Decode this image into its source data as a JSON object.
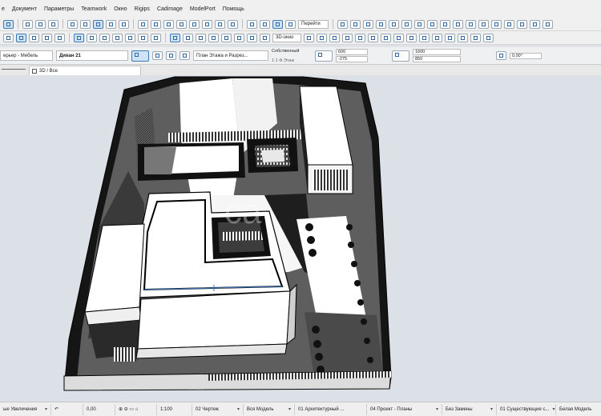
{
  "menu": [
    "е",
    "Документ",
    "Параметры",
    "Teamwork",
    "Окно",
    "Rigips",
    "Cadimage",
    "ModelPort",
    "Помощь"
  ],
  "toolbar": {
    "goto_label": "Перейти",
    "view_3d_label": "3D-окно",
    "floor_plan_label": "План Этажа и Разрез...",
    "layer_label": "ерьер - Мебель",
    "object_label": "Диван 21",
    "composite_label": "Собственный",
    "scale_hint": "1:1 Ф.Этаж"
  },
  "infobox": {
    "width": "600",
    "offset": "-275",
    "height": "1600",
    "depth": "850",
    "angle": "0,00°"
  },
  "tab": {
    "label": "3D / Все"
  },
  "status": {
    "zoom_label": "ые Увеличения",
    "coord": "0,00",
    "scale": "1:100",
    "drawing": "02 Чертеж",
    "model": "Вся Модель",
    "arch": "01 Архитектурный ...",
    "project": "04 Проект - Планы",
    "renovation": "Без Замены",
    "existing": "01 Существующие с...",
    "white_model": "Белая Модель"
  },
  "watermark": "ca"
}
